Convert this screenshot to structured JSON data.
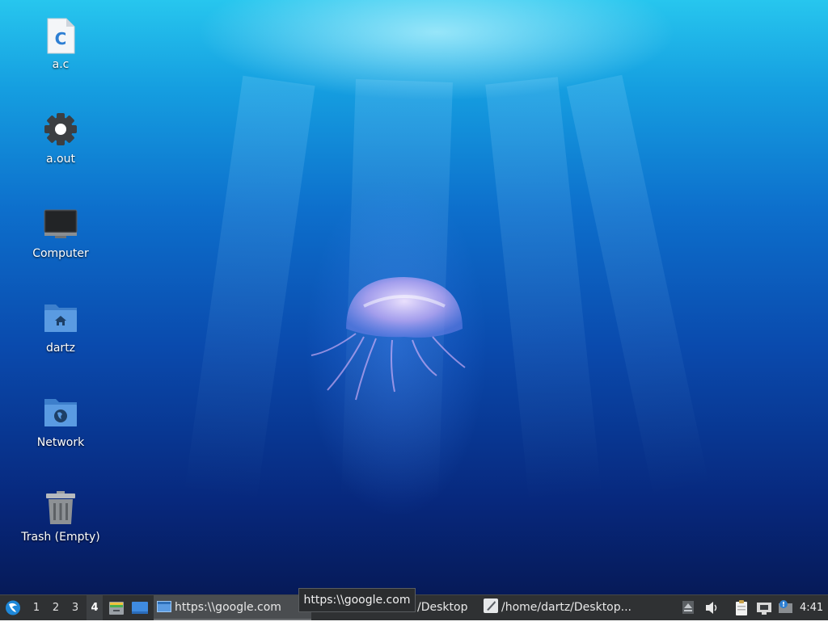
{
  "desktop": {
    "icons": [
      {
        "label": "a.c",
        "glyph": "C"
      },
      {
        "label": "a.out"
      },
      {
        "label": "Computer"
      },
      {
        "label": "dartz"
      },
      {
        "label": "Network"
      },
      {
        "label": "Trash (Empty)"
      }
    ]
  },
  "taskbar": {
    "workspaces": [
      "1",
      "2",
      "3",
      "4"
    ],
    "active_workspace": "4",
    "tasks": [
      {
        "label": "https:\\\\google.com"
      },
      {
        "label": "/Desktop"
      },
      {
        "label": "/home/dartz/Desktop..."
      }
    ],
    "tooltip": "https:\\\\google.com",
    "clock": "4:41"
  },
  "colors": {
    "taskbar_bg": "#2f3133",
    "folder_blue": "#4a8fd8",
    "accent_blue": "#2d7fd3"
  }
}
